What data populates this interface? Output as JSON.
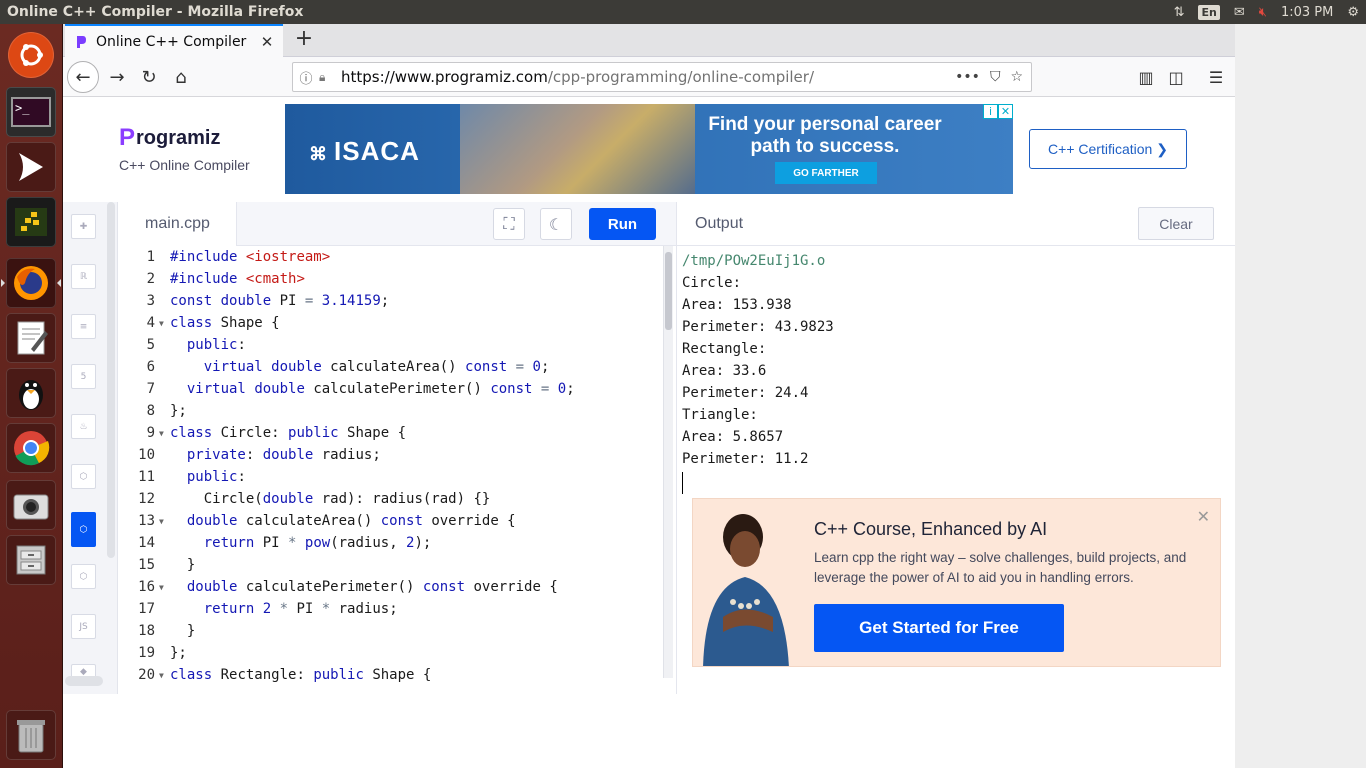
{
  "os": {
    "window_title": "Online C++ Compiler - Mozilla Firefox",
    "lang": "En",
    "clock": "1:03 PM"
  },
  "browser": {
    "tab_title": "Online C++ Compiler",
    "url_host": "https://www.programiz.com",
    "url_path": "/cpp-programming/online-compiler/"
  },
  "header": {
    "brand": "rogramiz",
    "brand_p": "P",
    "subtitle": "C++ Online Compiler",
    "cert_button": "C++ Certification ❯"
  },
  "ad": {
    "brand": "ISACA",
    "headline": "Find your personal career path to success.",
    "cta": "GO FARTHER"
  },
  "editor": {
    "file_tab": "main.cpp",
    "run_label": "Run"
  },
  "output": {
    "title": "Output",
    "clear_label": "Clear",
    "lines": [
      "/tmp/POw2EuIj1G.o",
      "Circle:",
      "Area: 153.938",
      "Perimeter: 43.9823",
      "Rectangle:",
      "Area: 33.6",
      "Perimeter: 24.4",
      "Triangle:",
      "Area: 5.8657",
      "Perimeter: 11.2"
    ]
  },
  "promo": {
    "title": "C++ Course, Enhanced by AI",
    "description": "Learn cpp the right way – solve challenges, build projects, and leverage the power of AI to aid you in handling errors.",
    "button": "Get Started for Free"
  },
  "code_lines": [
    {
      "n": "1",
      "fold": false,
      "html": "<span class='pp'>#include</span> <span class='str'>&lt;iostream&gt;</span>"
    },
    {
      "n": "2",
      "fold": false,
      "html": "<span class='pp'>#include</span> <span class='str'>&lt;cmath&gt;</span>"
    },
    {
      "n": "3",
      "fold": false,
      "html": "<span class='kw'>const</span> <span class='kw'>double</span> PI <span class='op'>=</span> <span class='num'>3.14159</span>;"
    },
    {
      "n": "4",
      "fold": true,
      "html": "<span class='kw'>class</span> Shape {"
    },
    {
      "n": "5",
      "fold": false,
      "html": "  <span class='kw'>public</span>:"
    },
    {
      "n": "6",
      "fold": false,
      "html": "    <span class='kw'>virtual</span> <span class='kw'>double</span> calculateArea() <span class='kw'>const</span> <span class='op'>=</span> <span class='num'>0</span>;"
    },
    {
      "n": "7",
      "fold": false,
      "html": "  <span class='kw'>virtual</span> <span class='kw'>double</span> calculatePerimeter() <span class='kw'>const</span> <span class='op'>=</span> <span class='num'>0</span>;"
    },
    {
      "n": "8",
      "fold": false,
      "html": "};"
    },
    {
      "n": "9",
      "fold": true,
      "html": "<span class='kw'>class</span> Circle: <span class='kw'>public</span> Shape {"
    },
    {
      "n": "10",
      "fold": false,
      "html": "  <span class='kw'>private</span>: <span class='kw'>double</span> radius;"
    },
    {
      "n": "11",
      "fold": false,
      "html": "  <span class='kw'>public</span>:"
    },
    {
      "n": "12",
      "fold": false,
      "html": "    Circle(<span class='kw'>double</span> rad): radius(rad) {}"
    },
    {
      "n": "13",
      "fold": true,
      "html": "  <span class='kw'>double</span> calculateArea() <span class='kw'>const</span> override {"
    },
    {
      "n": "14",
      "fold": false,
      "html": "    <span class='kw'>return</span> PI <span class='op'>*</span> <span class='kw'>pow</span>(radius, <span class='num'>2</span>);"
    },
    {
      "n": "15",
      "fold": false,
      "html": "  }"
    },
    {
      "n": "16",
      "fold": true,
      "html": "  <span class='kw'>double</span> calculatePerimeter() <span class='kw'>const</span> override {"
    },
    {
      "n": "17",
      "fold": false,
      "html": "    <span class='kw'>return</span> <span class='num'>2</span> <span class='op'>*</span> PI <span class='op'>*</span> radius;"
    },
    {
      "n": "18",
      "fold": false,
      "html": "  }"
    },
    {
      "n": "19",
      "fold": false,
      "html": "};"
    },
    {
      "n": "20",
      "fold": true,
      "html": "<span class='kw'>class</span> Rectangle: <span class='kw'>public</span> Shape {"
    }
  ],
  "colors": {
    "accent": "#0556f3",
    "panel": "#3c3b37",
    "launcher": "#5a1f1a"
  }
}
